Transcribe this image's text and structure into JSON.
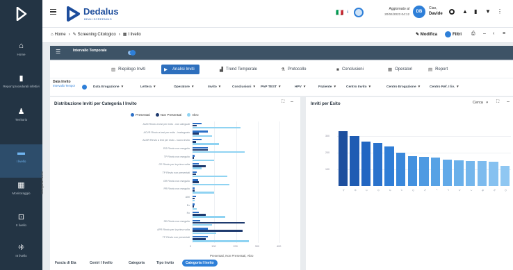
{
  "app": {
    "brand_name": "Dedalus",
    "brand_sub": "BEAH SCREENING",
    "status_label": "Aggiornato al",
    "status_time": "20/04/2023 04:12",
    "user_initials": "DB",
    "user_greeting": "Ciao,",
    "user_name": "Davide",
    "lang_flag": "🇮🇹"
  },
  "sidebar": [
    {
      "icon": "home-icon",
      "label": "Home"
    },
    {
      "icon": "document-icon",
      "label": "Report procedurali infettivi"
    },
    {
      "icon": "person-icon",
      "label": "Territorio"
    },
    {
      "icon": "chart-icon",
      "label": "I livello"
    },
    {
      "icon": "calendar-icon",
      "label": "Monitoraggio"
    },
    {
      "icon": "scan-icon",
      "label": "II livello"
    },
    {
      "icon": "network-icon",
      "label": "III livello"
    }
  ],
  "breadcrumb": {
    "home": "Home",
    "screening": "Screening Citologico",
    "level": "I livello"
  },
  "toolbar": {
    "modifica": "Modifica",
    "filtri": "Filtri"
  },
  "filter_bar": {
    "label": "Intervallo Temporale"
  },
  "tabs": [
    {
      "icon": "▥",
      "label": "Riepilogo Inviti"
    },
    {
      "icon": "▶",
      "label": "Analisi Inviti",
      "active": true
    },
    {
      "icon": "▟",
      "label": "Trend Temporale"
    },
    {
      "icon": "⚗",
      "label": "Protocollo"
    },
    {
      "icon": "■",
      "label": "Conclusioni"
    },
    {
      "icon": "▦",
      "label": "Operatori"
    },
    {
      "icon": "▤",
      "label": "Report"
    }
  ],
  "filters": {
    "data_invito_label": "Data Invito",
    "data_invito_value": "Intervallo Temporal...",
    "items": [
      "Data Erogazione",
      "Lettera",
      "Operatore",
      "Invito",
      "Conclusioni",
      "PAP TEST",
      "HPV",
      "Paziente",
      "Centro Invito",
      "Centro Erogazione",
      "Centro Ref. I liv."
    ]
  },
  "left_card": {
    "title": "Distribuzione Inviti per Categoria I Invito",
    "y_axis_label": "Categoria I Invito",
    "x_axis_label": "Presentati, Non Presentati, Altro"
  },
  "right_card": {
    "title": "Inviti per Esito",
    "search_label": "Cerca"
  },
  "chips": [
    "Fascia di Eta",
    "Centri I livello",
    "Categoria",
    "Tipo Invito",
    "Categoria I Invito"
  ],
  "colors": {
    "presentati": "#2b6fc7",
    "non_presentati": "#1e3a6e",
    "altro": "#8fd3f2",
    "accent": "#2e7fd8",
    "sidebar": "#233444"
  },
  "chart_data": [
    {
      "type": "bar",
      "orientation": "horizontal",
      "title": "Distribuzione Inviti per Categoria I Invito",
      "ylabel": "Categoria I Invito",
      "xlabel": "Presentati, Non Presentati, Altro",
      "categories": [
        "AUM Rinvio a test per esito - non adeguati",
        "ACVR Rinvio a test per esito - inadeguato",
        "ALMR Rinvio a test per esito - nuovo invito",
        "RG Rinvio non eseguito",
        "TP Rinvio non eseguito",
        "CE Rinvio per la prima volta",
        "TP Rinvio non presentati",
        "GR Rinvio non eseguito",
        "PR Rinvio non eseguito",
        "Altri",
        "Ex",
        "Rx",
        "SD Rinvio non eseguito",
        "APR Rinvio per la prima volta",
        "TP Rinvio non presentati"
      ],
      "x_ticks": [
        "0",
        "100",
        "200",
        "300",
        "400"
      ],
      "legend": [
        "Presentati",
        "Non Presentati",
        "Altro"
      ],
      "series": [
        {
          "name": "Presentati",
          "values": [
            40,
            70,
            40,
            70,
            10,
            30,
            20,
            25,
            10,
            15,
            8,
            30,
            35,
            70,
            70
          ]
        },
        {
          "name": "Non Presentati",
          "values": [
            20,
            30,
            15,
            70,
            5,
            60,
            15,
            30,
            10,
            10,
            5,
            60,
            240,
            230,
            60
          ]
        },
        {
          "name": "Altro",
          "values": [
            220,
            90,
            120,
            240,
            100,
            40,
            160,
            170,
            100,
            10,
            20,
            150,
            90,
            110,
            260
          ]
        }
      ]
    },
    {
      "type": "bar",
      "title": "Inviti per Esito",
      "y_ticks": [
        "300",
        "200",
        "100"
      ],
      "categories": [
        "A",
        "B",
        "C",
        "D",
        "E",
        "F",
        "G",
        "H",
        "I",
        "J",
        "K",
        "L",
        "M",
        "N",
        "O"
      ],
      "values": [
        330,
        300,
        270,
        260,
        240,
        200,
        180,
        175,
        170,
        160,
        155,
        150,
        150,
        145,
        120
      ]
    }
  ]
}
